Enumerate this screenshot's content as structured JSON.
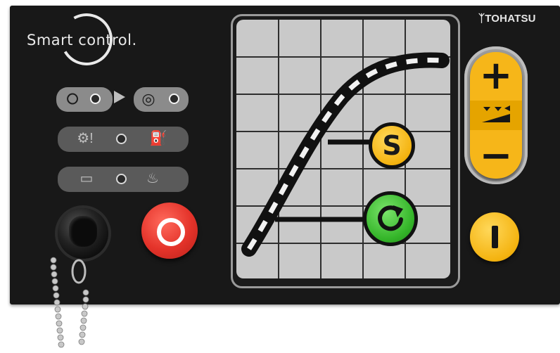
{
  "panel": {
    "brand_text": "Smart control.",
    "manufacturer": "TOHATSU",
    "manufacturer_mark": "ᛉ"
  },
  "indicators": [
    {
      "id": "preheat",
      "icon": "glow-plug-icon"
    },
    {
      "id": "turbo",
      "icon": "turbo-icon"
    },
    {
      "id": "overheat",
      "icon": "engine-warning-icon"
    },
    {
      "id": "oil",
      "icon": "oil-can-icon"
    },
    {
      "id": "battery",
      "icon": "battery-icon"
    },
    {
      "id": "coolant",
      "icon": "coolant-icon"
    }
  ],
  "controls": {
    "stop_button": {
      "icon": "stop-ring-icon",
      "color": "#e4332a"
    },
    "s_button": {
      "label": "S",
      "color": "#f4b310"
    },
    "start_button": {
      "icon": "rotate-icon",
      "color": "#34b529"
    },
    "rocker": {
      "plus_label": "+",
      "minus_label": "−",
      "icon": "adjust-arrows-icon",
      "color": "#f6b619"
    },
    "idle_button": {
      "icon": "bar-icon",
      "color": "#f4b310"
    }
  },
  "accessories": {
    "socket": {
      "icon": "connector-socket-icon"
    },
    "chain": {
      "icon": "bead-chain-icon"
    }
  },
  "screen": {
    "grid": {
      "columns": 5,
      "rows": 7
    },
    "curve_color": "#111111",
    "dash_color": "#f2f2f2"
  }
}
